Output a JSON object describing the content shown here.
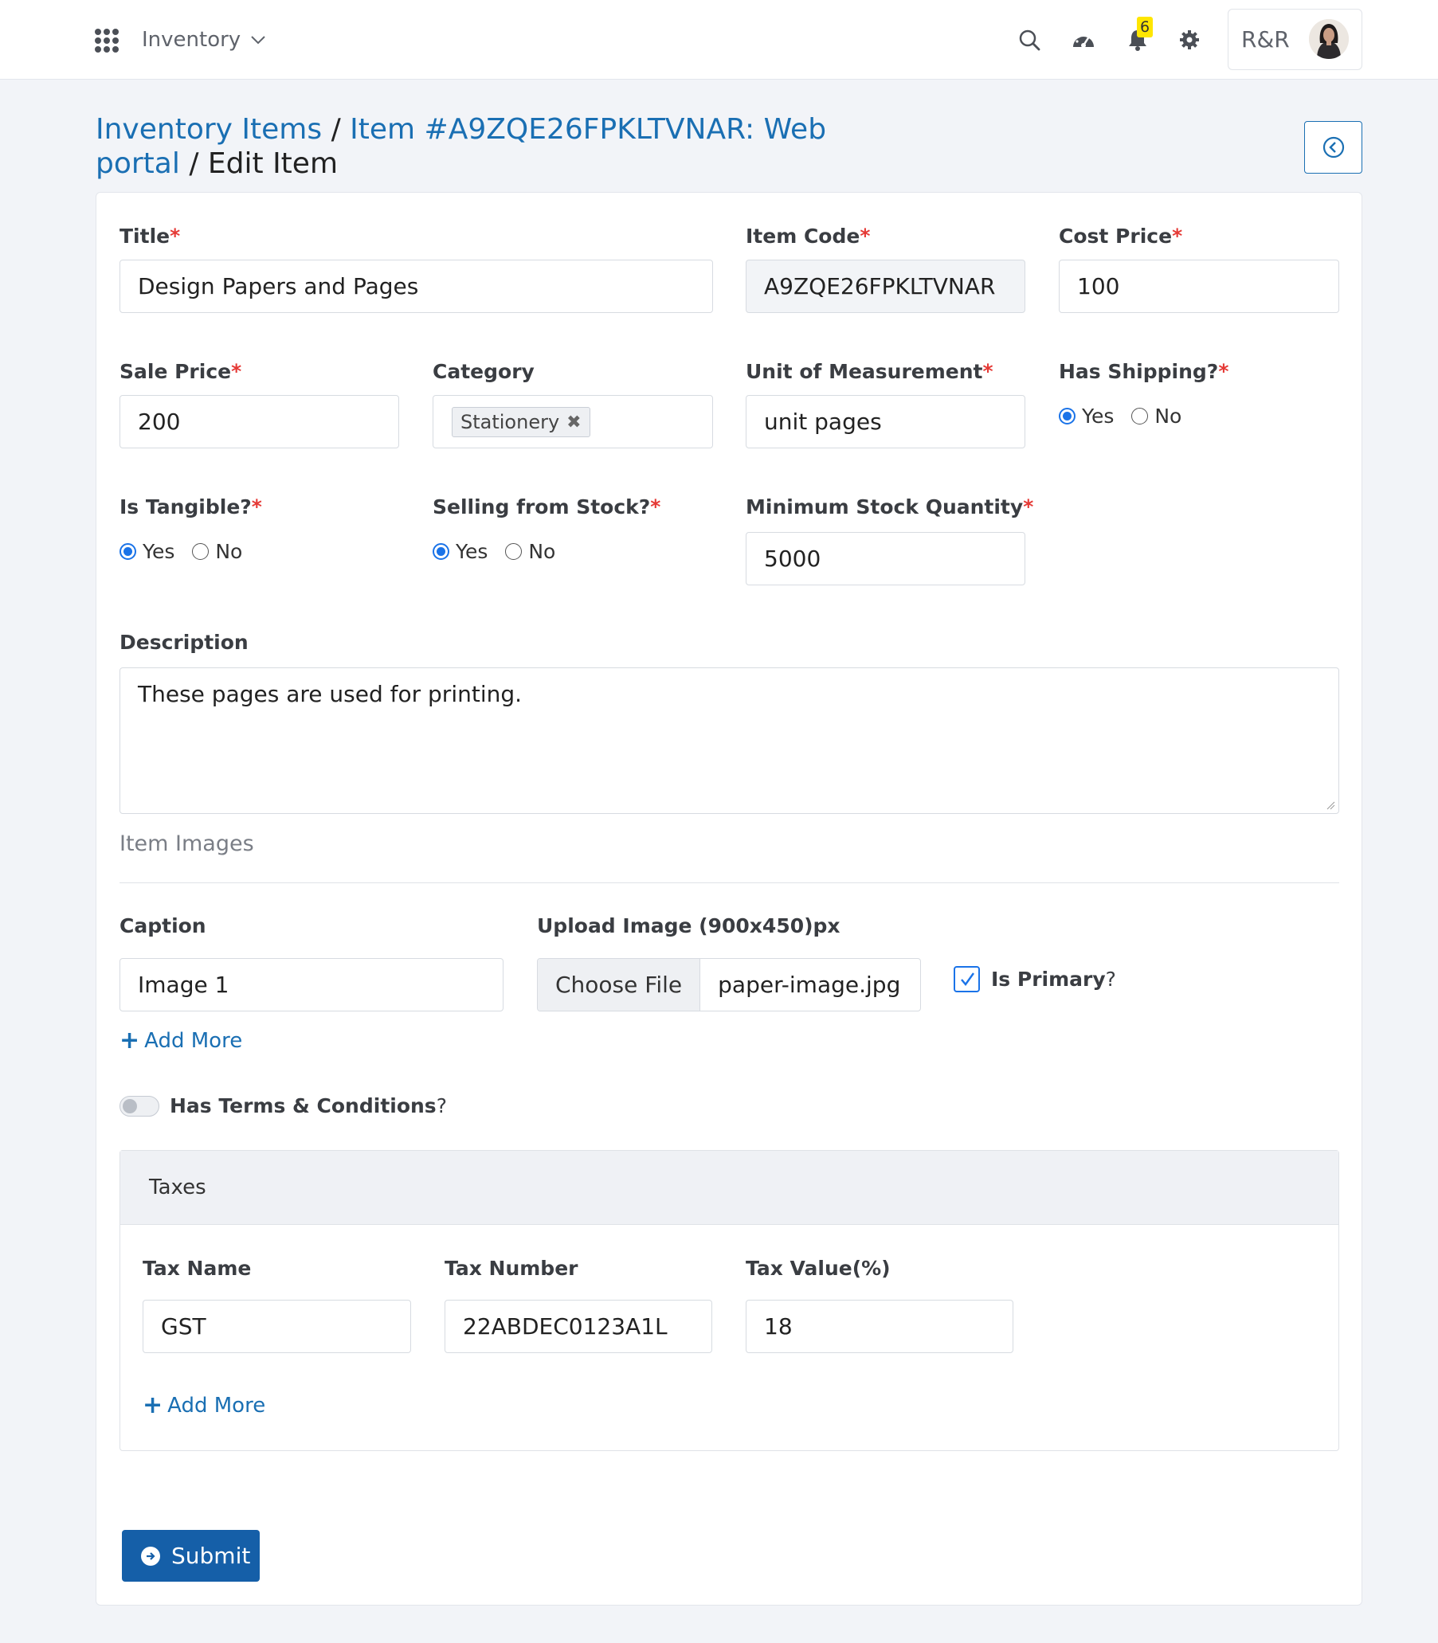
{
  "header": {
    "module": "Inventory",
    "notifications_count": "6",
    "user_name": "R&R"
  },
  "breadcrumb": {
    "items": [
      "Inventory Items",
      "Item #A9ZQE26FPKLTVNAR: Web portal"
    ],
    "separator": "/",
    "current": "Edit Item"
  },
  "form": {
    "title": {
      "label": "Title",
      "value": "Design Papers and Pages"
    },
    "item_code": {
      "label": "Item Code",
      "value": "A9ZQE26FPKLTVNAR"
    },
    "cost_price": {
      "label": "Cost Price",
      "value": "100"
    },
    "sale_price": {
      "label": "Sale Price",
      "value": "200"
    },
    "category": {
      "label": "Category",
      "tag": "Stationery"
    },
    "unit": {
      "label": "Unit of Measurement",
      "value": "unit pages"
    },
    "has_shipping": {
      "label": "Has Shipping?",
      "options": [
        "Yes",
        "No"
      ],
      "selected": "Yes"
    },
    "is_tangible": {
      "label": "Is Tangible?",
      "options": [
        "Yes",
        "No"
      ],
      "selected": "Yes"
    },
    "selling_from_stock": {
      "label": "Selling from Stock?",
      "options": [
        "Yes",
        "No"
      ],
      "selected": "Yes"
    },
    "min_stock": {
      "label": "Minimum Stock Quantity",
      "value": "5000"
    },
    "description": {
      "label": "Description",
      "value": "These pages are used for printing."
    },
    "required_mark": "*"
  },
  "images": {
    "section_title": "Item Images",
    "caption": {
      "label": "Caption",
      "value": "Image 1"
    },
    "upload": {
      "label": "Upload Image (900x450)px",
      "button": "Choose File",
      "file_name": "paper-image.jpg"
    },
    "is_primary": {
      "label": "Is Primary",
      "suffix": "?",
      "checked": true
    },
    "add_more": "Add More"
  },
  "terms": {
    "label": "Has Terms & Conditions",
    "suffix": "?",
    "enabled": false
  },
  "taxes": {
    "title": "Taxes",
    "tax_name": {
      "label": "Tax Name",
      "value": "GST"
    },
    "tax_number": {
      "label": "Tax Number",
      "value": "22ABDEC0123A1L"
    },
    "tax_value": {
      "label": "Tax Value(%)",
      "value": "18"
    },
    "add_more": "Add More"
  },
  "submit_label": "Submit",
  "colors": {
    "link": "#1a6fb3",
    "primary_button": "#155fa8",
    "required": "#e53935",
    "badge": "#ffe600",
    "radio": "#1a73e8"
  },
  "icons": [
    "apps-grid-icon",
    "chevron-down-icon",
    "search-icon",
    "dashboard-gauge-icon",
    "bell-icon",
    "gear-icon",
    "back-circle-icon",
    "close-icon",
    "check-icon",
    "plus-icon",
    "arrow-right-circle-icon"
  ]
}
